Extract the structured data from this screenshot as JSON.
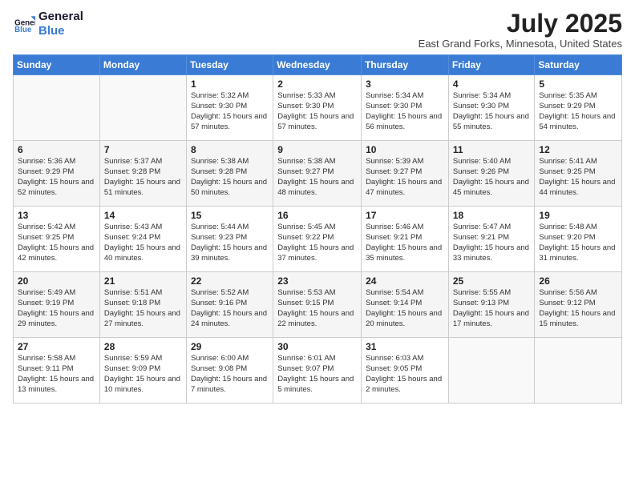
{
  "logo": {
    "line1": "General",
    "line2": "Blue"
  },
  "title": "July 2025",
  "location": "East Grand Forks, Minnesota, United States",
  "weekdays": [
    "Sunday",
    "Monday",
    "Tuesday",
    "Wednesday",
    "Thursday",
    "Friday",
    "Saturday"
  ],
  "weeks": [
    [
      {
        "day": "",
        "info": ""
      },
      {
        "day": "",
        "info": ""
      },
      {
        "day": "1",
        "info": "Sunrise: 5:32 AM\nSunset: 9:30 PM\nDaylight: 15 hours and 57 minutes."
      },
      {
        "day": "2",
        "info": "Sunrise: 5:33 AM\nSunset: 9:30 PM\nDaylight: 15 hours and 57 minutes."
      },
      {
        "day": "3",
        "info": "Sunrise: 5:34 AM\nSunset: 9:30 PM\nDaylight: 15 hours and 56 minutes."
      },
      {
        "day": "4",
        "info": "Sunrise: 5:34 AM\nSunset: 9:30 PM\nDaylight: 15 hours and 55 minutes."
      },
      {
        "day": "5",
        "info": "Sunrise: 5:35 AM\nSunset: 9:29 PM\nDaylight: 15 hours and 54 minutes."
      }
    ],
    [
      {
        "day": "6",
        "info": "Sunrise: 5:36 AM\nSunset: 9:29 PM\nDaylight: 15 hours and 52 minutes."
      },
      {
        "day": "7",
        "info": "Sunrise: 5:37 AM\nSunset: 9:28 PM\nDaylight: 15 hours and 51 minutes."
      },
      {
        "day": "8",
        "info": "Sunrise: 5:38 AM\nSunset: 9:28 PM\nDaylight: 15 hours and 50 minutes."
      },
      {
        "day": "9",
        "info": "Sunrise: 5:38 AM\nSunset: 9:27 PM\nDaylight: 15 hours and 48 minutes."
      },
      {
        "day": "10",
        "info": "Sunrise: 5:39 AM\nSunset: 9:27 PM\nDaylight: 15 hours and 47 minutes."
      },
      {
        "day": "11",
        "info": "Sunrise: 5:40 AM\nSunset: 9:26 PM\nDaylight: 15 hours and 45 minutes."
      },
      {
        "day": "12",
        "info": "Sunrise: 5:41 AM\nSunset: 9:25 PM\nDaylight: 15 hours and 44 minutes."
      }
    ],
    [
      {
        "day": "13",
        "info": "Sunrise: 5:42 AM\nSunset: 9:25 PM\nDaylight: 15 hours and 42 minutes."
      },
      {
        "day": "14",
        "info": "Sunrise: 5:43 AM\nSunset: 9:24 PM\nDaylight: 15 hours and 40 minutes."
      },
      {
        "day": "15",
        "info": "Sunrise: 5:44 AM\nSunset: 9:23 PM\nDaylight: 15 hours and 39 minutes."
      },
      {
        "day": "16",
        "info": "Sunrise: 5:45 AM\nSunset: 9:22 PM\nDaylight: 15 hours and 37 minutes."
      },
      {
        "day": "17",
        "info": "Sunrise: 5:46 AM\nSunset: 9:21 PM\nDaylight: 15 hours and 35 minutes."
      },
      {
        "day": "18",
        "info": "Sunrise: 5:47 AM\nSunset: 9:21 PM\nDaylight: 15 hours and 33 minutes."
      },
      {
        "day": "19",
        "info": "Sunrise: 5:48 AM\nSunset: 9:20 PM\nDaylight: 15 hours and 31 minutes."
      }
    ],
    [
      {
        "day": "20",
        "info": "Sunrise: 5:49 AM\nSunset: 9:19 PM\nDaylight: 15 hours and 29 minutes."
      },
      {
        "day": "21",
        "info": "Sunrise: 5:51 AM\nSunset: 9:18 PM\nDaylight: 15 hours and 27 minutes."
      },
      {
        "day": "22",
        "info": "Sunrise: 5:52 AM\nSunset: 9:16 PM\nDaylight: 15 hours and 24 minutes."
      },
      {
        "day": "23",
        "info": "Sunrise: 5:53 AM\nSunset: 9:15 PM\nDaylight: 15 hours and 22 minutes."
      },
      {
        "day": "24",
        "info": "Sunrise: 5:54 AM\nSunset: 9:14 PM\nDaylight: 15 hours and 20 minutes."
      },
      {
        "day": "25",
        "info": "Sunrise: 5:55 AM\nSunset: 9:13 PM\nDaylight: 15 hours and 17 minutes."
      },
      {
        "day": "26",
        "info": "Sunrise: 5:56 AM\nSunset: 9:12 PM\nDaylight: 15 hours and 15 minutes."
      }
    ],
    [
      {
        "day": "27",
        "info": "Sunrise: 5:58 AM\nSunset: 9:11 PM\nDaylight: 15 hours and 13 minutes."
      },
      {
        "day": "28",
        "info": "Sunrise: 5:59 AM\nSunset: 9:09 PM\nDaylight: 15 hours and 10 minutes."
      },
      {
        "day": "29",
        "info": "Sunrise: 6:00 AM\nSunset: 9:08 PM\nDaylight: 15 hours and 7 minutes."
      },
      {
        "day": "30",
        "info": "Sunrise: 6:01 AM\nSunset: 9:07 PM\nDaylight: 15 hours and 5 minutes."
      },
      {
        "day": "31",
        "info": "Sunrise: 6:03 AM\nSunset: 9:05 PM\nDaylight: 15 hours and 2 minutes."
      },
      {
        "day": "",
        "info": ""
      },
      {
        "day": "",
        "info": ""
      }
    ]
  ]
}
